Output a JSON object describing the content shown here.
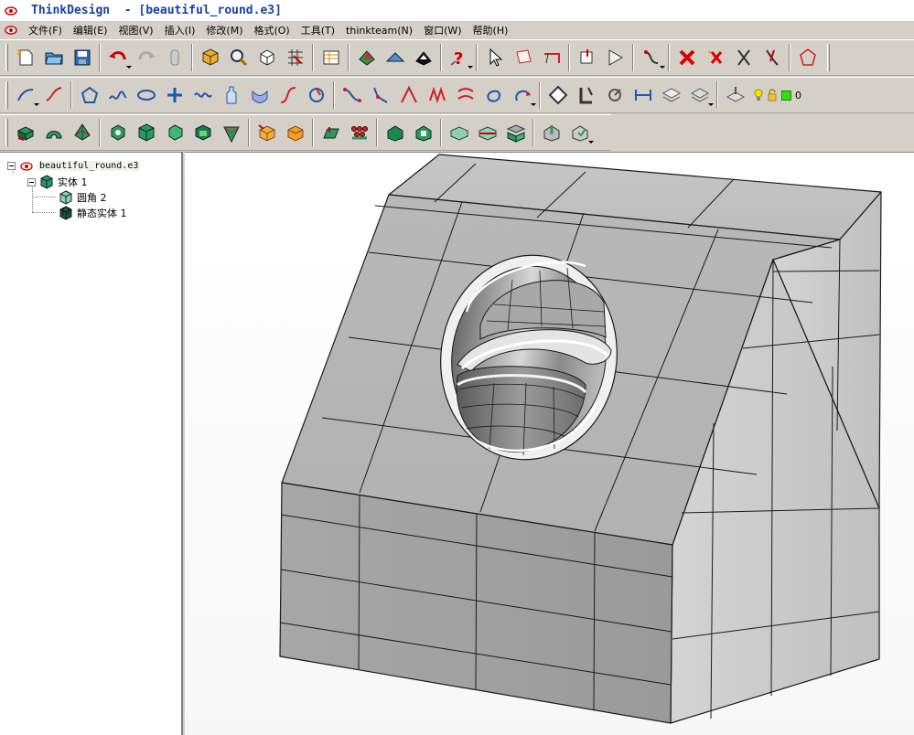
{
  "window": {
    "title": "ThinkDesign  - [beautiful_round.e3]"
  },
  "menubar": {
    "items": [
      {
        "label": "文件(F)"
      },
      {
        "label": "编辑(E)"
      },
      {
        "label": "视图(V)"
      },
      {
        "label": "插入(I)"
      },
      {
        "label": "修改(M)"
      },
      {
        "label": "格式(O)"
      },
      {
        "label": "工具(T)"
      },
      {
        "label": "thinkteam(N)"
      },
      {
        "label": "窗口(W)"
      },
      {
        "label": "帮助(H)"
      }
    ]
  },
  "toolbar1": {
    "icons": [
      "new-file-icon",
      "open-folder-icon",
      "save-icon",
      "undo-icon",
      "redo-icon",
      "trash-icon",
      "cube-icon",
      "zoom-icon",
      "orient-cube-icon",
      "grid-icon",
      "table-icon",
      "sheet-icon",
      "mesh-icon",
      "render-icon",
      "help-icon",
      "select-arrow-icon",
      "select-face-icon",
      "select-edge-icon",
      "pin-icon",
      "flag-icon",
      "curve-select-icon",
      "delete-icon",
      "star-delete-icon",
      "cut-icon",
      "trim-icon",
      "polygon-icon"
    ]
  },
  "toolbar2": {
    "icons": [
      "sketch-curve-icon",
      "freehand-icon",
      "polygon-sketch-icon",
      "spline-icon",
      "ellipse-icon",
      "cross-icon",
      "wave-icon",
      "bottle-icon",
      "sweep-icon",
      "blend-curve-icon",
      "circle-curve-icon",
      "point-curve-icon",
      "vertex-curve-icon",
      "angle-icon",
      "zigzag-icon",
      "offset-icon",
      "loop-icon",
      "arc-arrow-icon",
      "plane-icon",
      "corner-icon",
      "rotate-icon",
      "dimension-icon",
      "layer-stack-icon",
      "layer-stack2-icon",
      "layer-manage-icon",
      "bulb-icon",
      "lock-icon"
    ],
    "layer_value": "0",
    "layer_color": "#33dd11"
  },
  "toolbar3": {
    "icons": [
      "solid-box-icon",
      "solid-arc-icon",
      "solid-pyramid-icon",
      "shell-icon",
      "extrude-icon",
      "revolve-icon",
      "boolean-icon",
      "shape-icon",
      "box-yellow-icon",
      "box-orange-icon",
      "pad-icon",
      "pattern-icon",
      "block-icon",
      "slot-icon",
      "blend-icon",
      "split-icon",
      "layer-solid-icon",
      "measure-icon",
      "check-icon"
    ]
  },
  "tree": {
    "root_label": "beautiful_round.e3",
    "solid_label": "实体 1",
    "fillet_label": "圆角 2",
    "static_solid_label": "静态实体 1"
  },
  "model": {
    "face_color": "#a8a8a8",
    "edge_color": "#1a1a1a"
  }
}
